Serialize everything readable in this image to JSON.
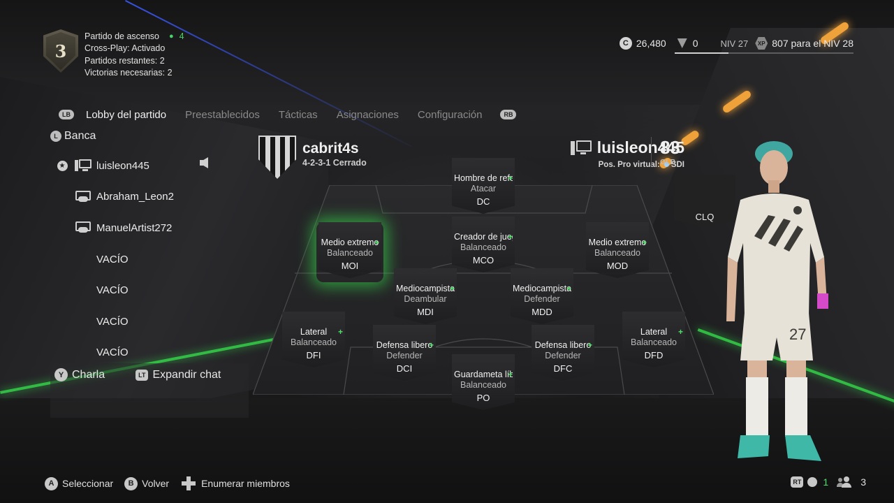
{
  "match": {
    "division_badge": "3",
    "title": "Partido de ascenso",
    "party_count": "4",
    "crossplay": "Cross-Play: Activado",
    "remaining": "Partidos restantes: 2",
    "wins_needed": "Victorias necesarias: 2"
  },
  "currency": {
    "coins": "26,480",
    "points": "0",
    "level": "NIV 27",
    "xp_text": "807 para el NIV 28",
    "xp_progress": 0.3
  },
  "tabs": {
    "left_button": "LB",
    "right_button": "RB",
    "items": [
      "Lobby del partido",
      "Preestablecidos",
      "Tácticas",
      "Asignaciones",
      "Configuración"
    ]
  },
  "roster": {
    "bench_label": "Banca",
    "players": [
      {
        "name": "luisleon445",
        "device": "pc",
        "leader": true
      },
      {
        "name": "Abraham_Leon2",
        "device": "console"
      },
      {
        "name": "ManuelArtist272",
        "device": "console"
      },
      {
        "name": "VACÍO"
      },
      {
        "name": "VACÍO"
      },
      {
        "name": "VACÍO"
      },
      {
        "name": "VACÍO"
      }
    ]
  },
  "chat": {
    "chat_button": "Y",
    "chat_label": "Charla",
    "expand_button": "LT",
    "expand_label": "Expandir chat"
  },
  "team": {
    "name": "cabrit4s",
    "formation": "4-2-3-1 Cerrado"
  },
  "player": {
    "username": "luisleon445",
    "pos_label": "Pos. Pro virtual:",
    "position": "SDI",
    "overall": "83",
    "overall_label": "GLB"
  },
  "positions": [
    {
      "role": "Hombre de referencia",
      "focus": "Atacar",
      "pos": "DC"
    },
    {
      "role": "Medio extremo",
      "focus": "Balanceado",
      "pos": "MOI"
    },
    {
      "role": "Creador de juego",
      "focus": "Balanceado",
      "pos": "MCO"
    },
    {
      "role": "Medio extremo",
      "focus": "Balanceado",
      "pos": "MOD"
    },
    {
      "role": "Mediocampista",
      "focus": "Deambular",
      "pos": "MDI"
    },
    {
      "role": "Mediocampista",
      "focus": "Defender",
      "pos": "MDD"
    },
    {
      "role": "Lateral",
      "focus": "Balanceado",
      "pos": "DFI"
    },
    {
      "role": "Defensa libero",
      "focus": "Defender",
      "pos": "DCI"
    },
    {
      "role": "Defensa libero",
      "focus": "Defender",
      "pos": "DFC"
    },
    {
      "role": "Lateral",
      "focus": "Balanceado",
      "pos": "DFD"
    },
    {
      "role": "Guardameta líbero",
      "focus": "Balanceado",
      "pos": "PO"
    }
  ],
  "extra_position": "CLQ",
  "footer": {
    "a_btn": "A",
    "a_label": "Seleccionar",
    "b_btn": "B",
    "b_label": "Volver",
    "list_label": "Enumerar miembros",
    "rt_btn": "RT",
    "voice_count": "1",
    "members_count": "3"
  },
  "colors": {
    "accent_green": "#35d64a",
    "plus_green": "#4ee06a"
  }
}
